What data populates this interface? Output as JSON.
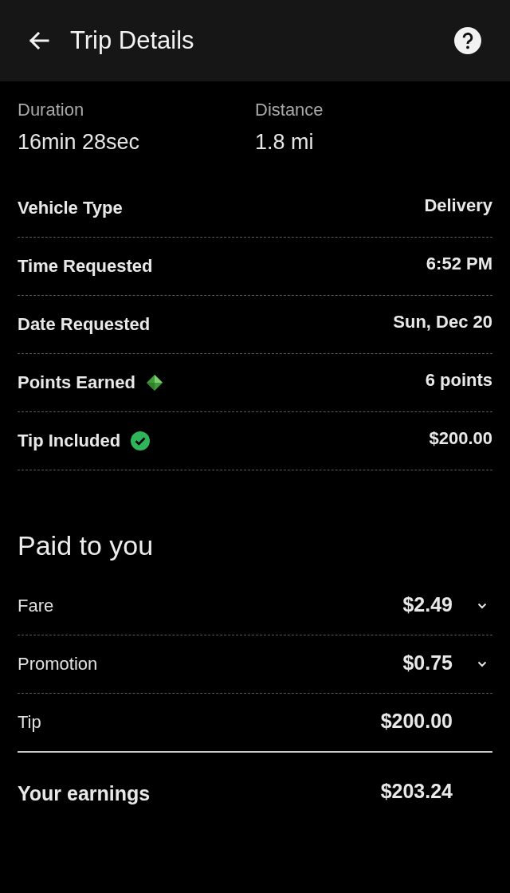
{
  "header": {
    "title": "Trip Details"
  },
  "stats": [
    {
      "label": "Duration",
      "value": "16min 28sec"
    },
    {
      "label": "Distance",
      "value": "1.8 mi"
    }
  ],
  "details": [
    {
      "kind": "plain",
      "label": "Vehicle Type",
      "value": "Delivery"
    },
    {
      "kind": "plain",
      "label": "Time Requested",
      "value": "6:52 PM"
    },
    {
      "kind": "plain",
      "label": "Date Requested",
      "value": "Sun, Dec 20"
    },
    {
      "kind": "points",
      "label": "Points Earned",
      "value": "6 points"
    },
    {
      "kind": "tip",
      "label": "Tip Included",
      "value": "$200.00"
    }
  ],
  "paid_to_you": {
    "title": "Paid to you",
    "items": [
      {
        "kind": "expandable",
        "label": "Fare",
        "amount": "$2.49",
        "expanded": false
      },
      {
        "kind": "expandable",
        "label": "Promotion",
        "amount": "$0.75",
        "expanded": false
      },
      {
        "kind": "plain",
        "label": "Tip",
        "amount": "$200.00"
      }
    ],
    "total": {
      "label": "Your earnings",
      "amount": "$203.24"
    }
  }
}
